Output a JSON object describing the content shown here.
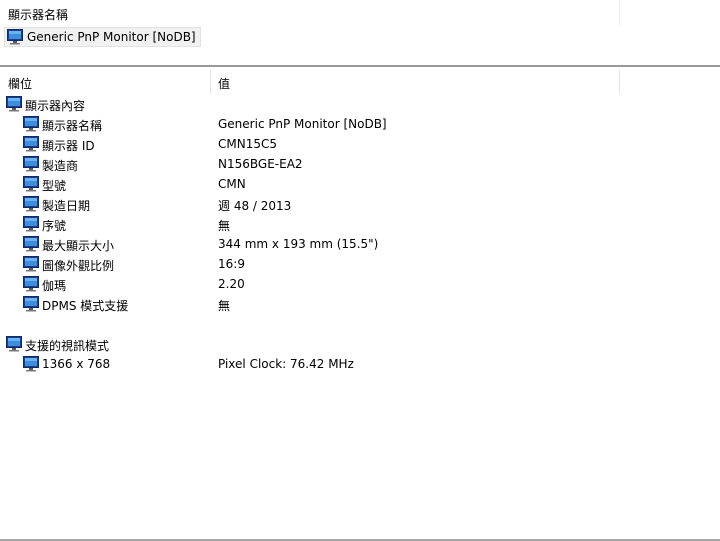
{
  "top": {
    "title": "顯示器名稱",
    "device": {
      "label": "Generic PnP Monitor [NoDB]",
      "icon": "monitor-icon"
    }
  },
  "columns": {
    "field": "欄位",
    "value": "值"
  },
  "sections": [
    {
      "title": "顯示器內容",
      "icon": "monitor-icon",
      "rows": [
        {
          "field": "顯示器名稱",
          "value": "Generic PnP Monitor [NoDB]"
        },
        {
          "field": "顯示器 ID",
          "value": "CMN15C5"
        },
        {
          "field": "製造商",
          "value": "N156BGE-EA2"
        },
        {
          "field": "型號",
          "value": "CMN"
        },
        {
          "field": "製造日期",
          "value": "週 48 / 2013"
        },
        {
          "field": "序號",
          "value": "無"
        },
        {
          "field": "最大顯示大小",
          "value": "344 mm x 193 mm (15.5\")"
        },
        {
          "field": "圖像外觀比例",
          "value": "16:9"
        },
        {
          "field": "伽瑪",
          "value": "2.20"
        },
        {
          "field": "DPMS 模式支援",
          "value": "無"
        }
      ]
    },
    {
      "title": "支援的視訊模式",
      "icon": "monitor-icon",
      "rows": [
        {
          "field": "1366 x 768",
          "value": "Pixel Clock: 76.42 MHz"
        }
      ]
    }
  ],
  "colors": {
    "icon_frame": "#1c3f8c",
    "icon_screen": "#3c8ede",
    "header_border": "#9a9a9a"
  }
}
